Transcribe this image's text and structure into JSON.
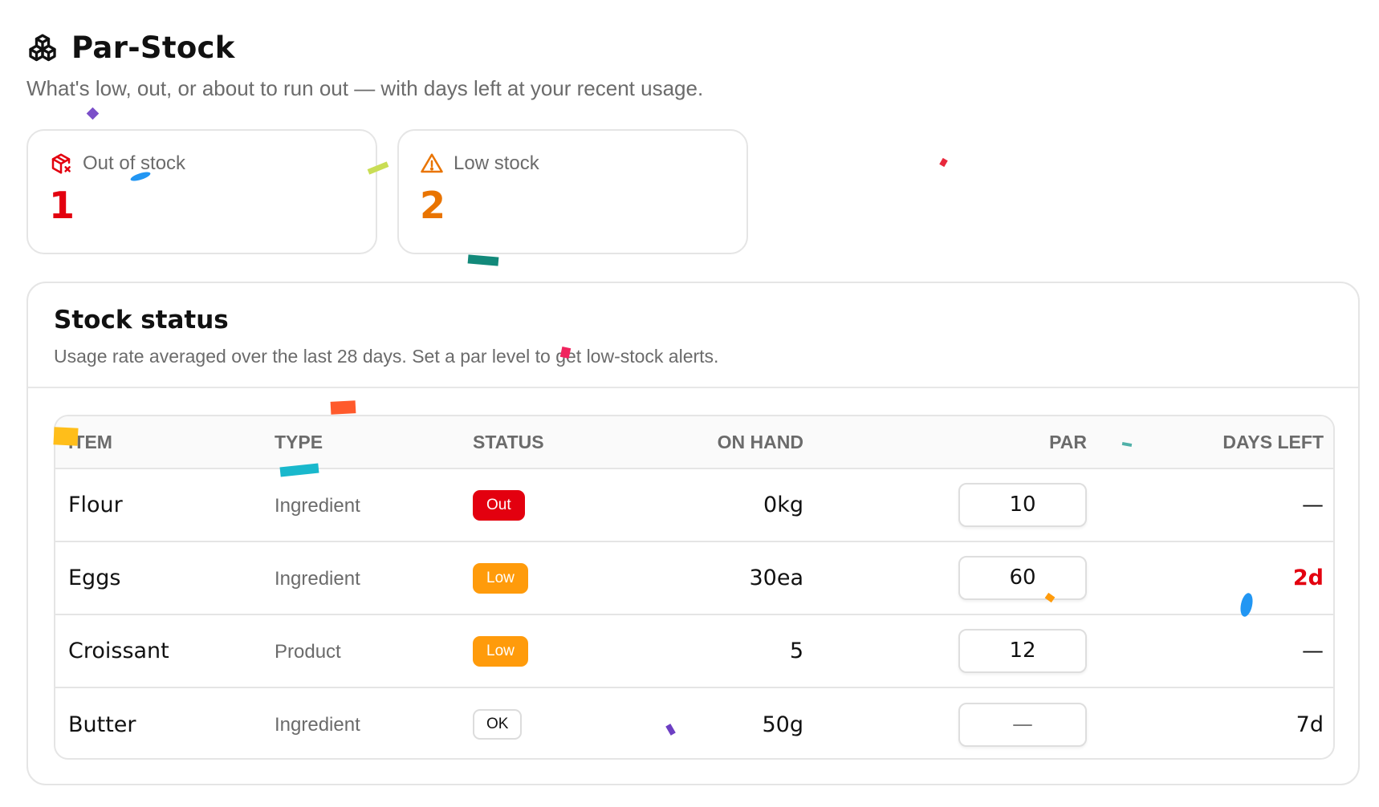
{
  "header": {
    "title": "Par-Stock",
    "subtitle": "What's low, out, or about to run out — with days left at your recent usage.",
    "icon": "boxes-icon"
  },
  "cards": [
    {
      "label": "Out of stock",
      "value": "1",
      "icon": "package-x-icon",
      "color": "#e3000f"
    },
    {
      "label": "Low stock",
      "value": "2",
      "icon": "alert-triangle-icon",
      "color": "#e97400"
    }
  ],
  "panel": {
    "title": "Stock status",
    "description": "Usage rate averaged over the last 28 days. Set a par level to get low-stock alerts."
  },
  "table": {
    "columns": [
      "Item",
      "Type",
      "Status",
      "On hand",
      "Par",
      "Days left"
    ],
    "rows": [
      {
        "item": "Flour",
        "type": "Ingredient",
        "status": "Out",
        "on_hand": "0kg",
        "par": "10",
        "days_left": "—"
      },
      {
        "item": "Eggs",
        "type": "Ingredient",
        "status": "Low",
        "on_hand": "30ea",
        "par": "60",
        "days_left": "2d"
      },
      {
        "item": "Croissant",
        "type": "Product",
        "status": "Low",
        "on_hand": "5",
        "par": "12",
        "days_left": "—"
      },
      {
        "item": "Butter",
        "type": "Ingredient",
        "status": "OK",
        "on_hand": "50g",
        "par": "—",
        "days_left": "7d"
      }
    ]
  },
  "colors": {
    "danger": "#e3000f",
    "warning": "#ff9b0b",
    "warning_text": "#e97400",
    "muted_text": "#6b6b6b",
    "border": "#e5e5e5"
  }
}
